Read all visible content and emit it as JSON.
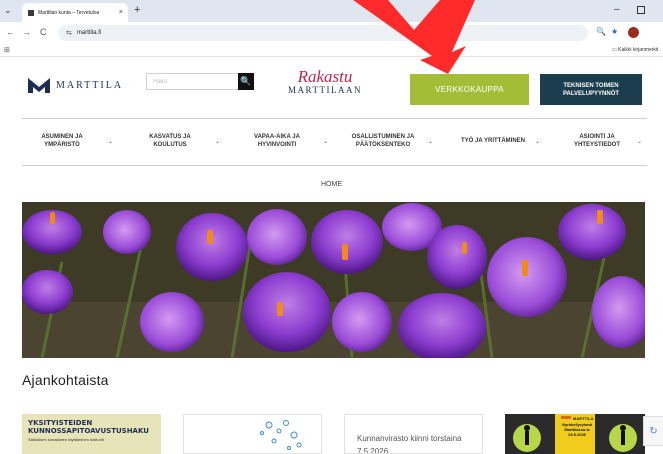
{
  "browser": {
    "tab_title": "Marttilan kunta – Tervetuloa",
    "tab_close": "×",
    "new_tab": "+",
    "url": "marttila.fi",
    "bookmark_folder": "Kaikki kirjanmerkit",
    "minimize": "–",
    "menu_glyph": "⌄",
    "back_glyph": "←",
    "forward_glyph": "→",
    "reload_glyph": "C",
    "site_glyph": "⇆",
    "zoom_glyph": "🔍",
    "star_glyph": "★",
    "apps_glyph": "⊞"
  },
  "site": {
    "logo_text": "MARTTILA",
    "search_placeholder": "Haku",
    "search_glyph": "🔍",
    "slogan_script": "Rakastu",
    "slogan_sub": "MARTTILAAN",
    "shop_button": "VERKKOKAUPPA",
    "tech_button": "TEKNISEN TOIMEN PALVELUPYYNNÖT",
    "nav": [
      {
        "label": "ASUMINEN JA YMPÄRISTÖ"
      },
      {
        "label": "KASVATUS JA KOULUTUS"
      },
      {
        "label": "VAPAA-AIKA JA HYVINVOINTI"
      },
      {
        "label": "OSALLISTUMINEN JA PÄÄTÖKSENTEKO"
      },
      {
        "label": "TYÖ JA YRITTÄMINEN"
      },
      {
        "label": "ASIOINTI JA YHTEYSTIEDOT"
      }
    ],
    "nav_chevron": "⌄",
    "breadcrumb": "HOME",
    "section_title": "Ajankohtaista",
    "cards": [
      {
        "title": "YKSITYISTEIDEN KUNNOSSAPITOAVUSTUSHAKU",
        "subtitle": "Sähköisen lomakkeen täyttäminen tukitunti"
      },
      {
        "title": ""
      },
      {
        "title": "Kunnanvirasto kiinni torstaina 7.5.2026"
      },
      {
        "title": "Nyrkkeilyryhmä Marttilassa la 23.5.2026",
        "brand": "MARTTILA"
      }
    ],
    "recaptcha_glyph": "↻"
  },
  "colors": {
    "shop_green": "#a5bc36",
    "tech_navy": "#1b3d4d",
    "brand_navy": "#1c2f52",
    "slogan_red": "#b42a4f",
    "arrow_red": "#ff2a2a",
    "card_yellow": "#f2cc1c",
    "card_cream": "#e8e4b9"
  }
}
